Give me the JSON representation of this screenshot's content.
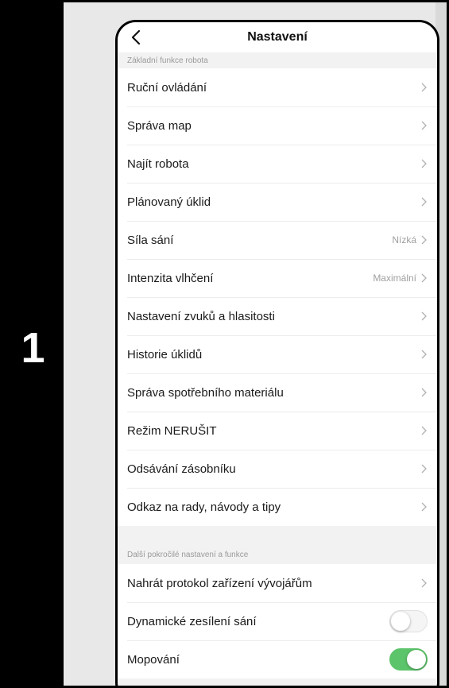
{
  "step_number": "1",
  "header": {
    "title": "Nastavení"
  },
  "section1": {
    "title": "Základní funkce robota",
    "items": [
      {
        "label": "Ruční ovládání",
        "value": ""
      },
      {
        "label": "Správa map",
        "value": ""
      },
      {
        "label": "Najít robota",
        "value": ""
      },
      {
        "label": "Plánovaný úklid",
        "value": ""
      },
      {
        "label": "Síla sání",
        "value": "Nízká"
      },
      {
        "label": "Intenzita vlhčení",
        "value": "Maximální"
      },
      {
        "label": "Nastavení zvuků a hlasitosti",
        "value": ""
      },
      {
        "label": "Historie úklidů",
        "value": ""
      },
      {
        "label": "Správa spotřebního materiálu",
        "value": ""
      },
      {
        "label": "Režim NERUŠIT",
        "value": ""
      },
      {
        "label": "Odsávání zásobníku",
        "value": ""
      },
      {
        "label": "Odkaz na rady, návody a tipy",
        "value": ""
      }
    ]
  },
  "section2": {
    "title": "Další pokročilé nastavení a funkce",
    "items": [
      {
        "label": "Nahrát protokol zařízení vývojářům"
      },
      {
        "label": "Dynamické zesílení sání",
        "toggle": false
      },
      {
        "label": "Mopování",
        "toggle": true
      }
    ]
  },
  "colors": {
    "toggle_on": "#5cc46a",
    "toggle_off": "#f5f5f5",
    "background": "#e8e8e8"
  }
}
